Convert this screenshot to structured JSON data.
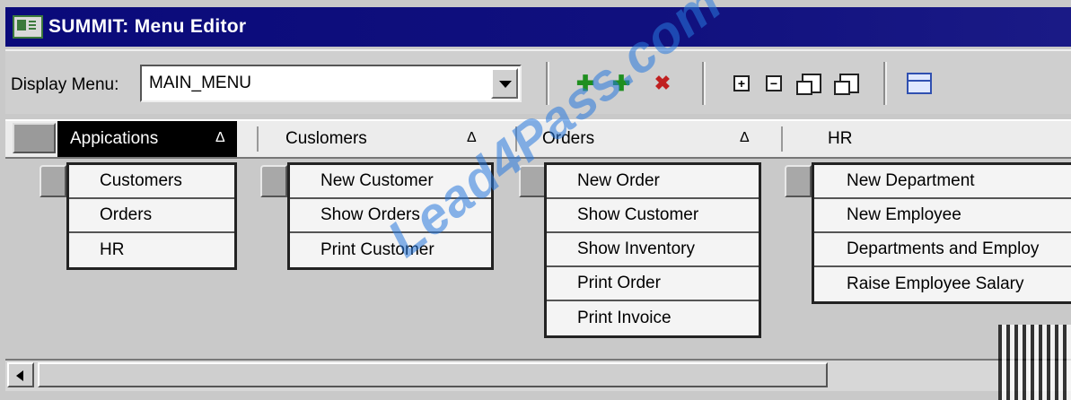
{
  "window": {
    "title": "SUMMIT: Menu Editor"
  },
  "toolbar": {
    "display_menu_label": "Display Menu:",
    "display_menu_value": "MAIN_MENU",
    "icons": [
      "create-right-icon",
      "create-down-icon",
      "delete-icon",
      "expand-icon",
      "collapse-icon",
      "expand-all-icon",
      "collapse-all-icon",
      "switch-orientation-icon"
    ]
  },
  "menubar": {
    "tabs": [
      {
        "label": "Appications",
        "arrow": "Δ"
      },
      {
        "label": "Cuslomers",
        "arrow": "Δ"
      },
      {
        "label": "Orders",
        "arrow": "Δ"
      },
      {
        "label": "HR"
      }
    ]
  },
  "submenus": [
    {
      "items": [
        "Customers",
        "Orders",
        "HR"
      ]
    },
    {
      "items": [
        "New Customer",
        "Show Orders",
        "Print Customer"
      ]
    },
    {
      "items": [
        "New Order",
        "Show Customer",
        "Show Inventory",
        "Print Order",
        "Print Invoice"
      ]
    },
    {
      "items": [
        "New Department",
        "New Employee",
        "Departments and Employ",
        "Raise Employee Salary"
      ]
    }
  ],
  "watermark": "Lead4Pass.com"
}
